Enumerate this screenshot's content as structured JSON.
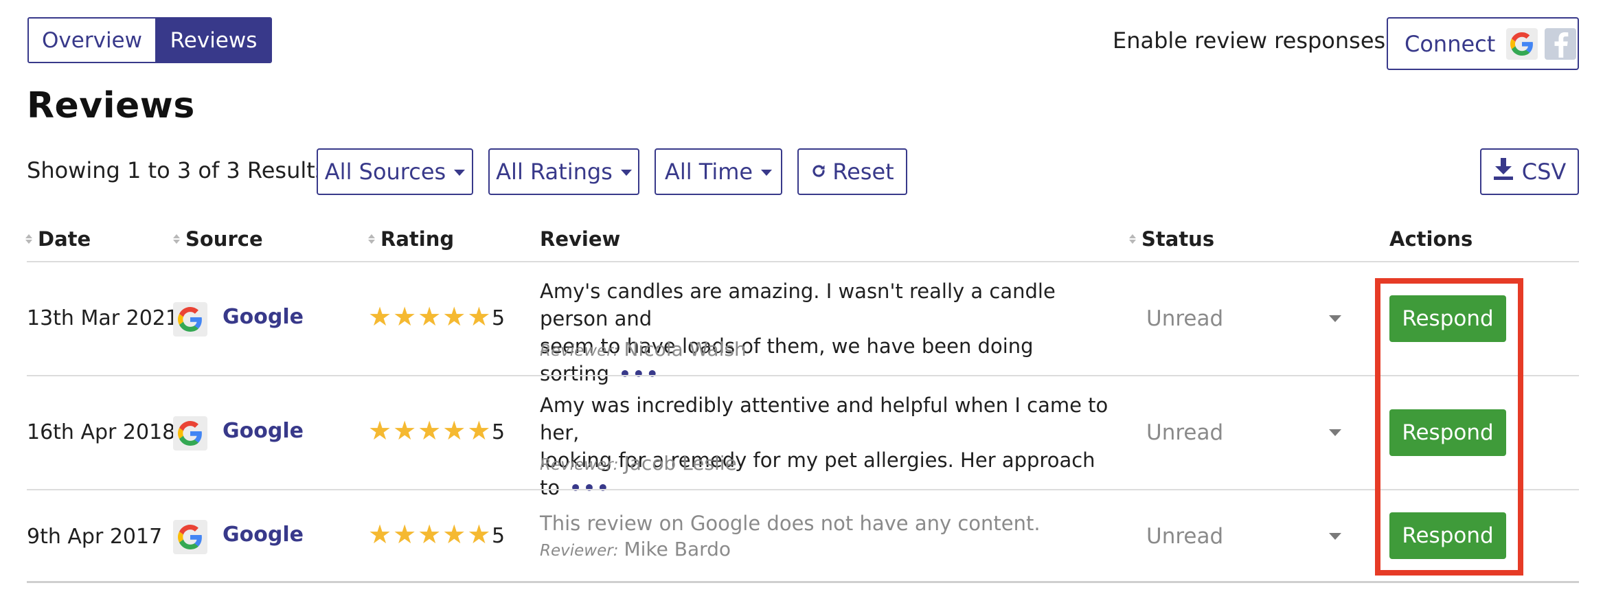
{
  "tabs": [
    {
      "label": "Overview",
      "active": false
    },
    {
      "label": "Reviews",
      "active": true
    }
  ],
  "header": {
    "enable_label": "Enable review responses:",
    "connect_label": "Connect"
  },
  "page_title": "Reviews",
  "filters": {
    "results_text": "Showing 1 to 3 of 3 Results",
    "sources": "All Sources",
    "ratings": "All Ratings",
    "time": "All Time",
    "reset": "Reset",
    "csv": "CSV"
  },
  "table": {
    "headers": {
      "date": "Date",
      "source": "Source",
      "rating": "Rating",
      "review": "Review",
      "status": "Status",
      "actions": "Actions"
    },
    "rows": [
      {
        "date": "13th Mar 2021",
        "source": "Google",
        "stars": 5,
        "rating": "5",
        "review_line1": "Amy's candles are amazing. I wasn't really a candle person and",
        "review_line2": "seem to have loads of them, we have been doing sorting",
        "more": "•••",
        "reviewer_label": "Reviewer:",
        "reviewer": "Nicola Walsh",
        "status": "Unread",
        "action": "Respond"
      },
      {
        "date": "16th Apr 2018",
        "source": "Google",
        "stars": 5,
        "rating": "5",
        "review_line1": "Amy was incredibly attentive and helpful when I came to her,",
        "review_line2": "looking for a remedy for my pet allergies. Her approach to",
        "more": "•••",
        "reviewer_label": "Reviewer:",
        "reviewer": "Jacob Leslie",
        "status": "Unread",
        "action": "Respond"
      },
      {
        "date": "9th Apr 2017",
        "source": "Google",
        "stars": 5,
        "rating": "5",
        "review_line1": "This review on Google does not have any content.",
        "reviewer_label": "Reviewer:",
        "reviewer": "Mike Bardo",
        "status": "Unread",
        "action": "Respond"
      }
    ]
  },
  "colors": {
    "brand": "#38398a",
    "respond_green": "#3f9b3a",
    "star": "#f5b931",
    "highlight": "#e63b26"
  },
  "icons": {
    "google": "google-logo-icon",
    "facebook": "facebook-logo-icon",
    "reset": "refresh-icon",
    "csv": "download-icon",
    "more": "ellipsis-icon"
  }
}
